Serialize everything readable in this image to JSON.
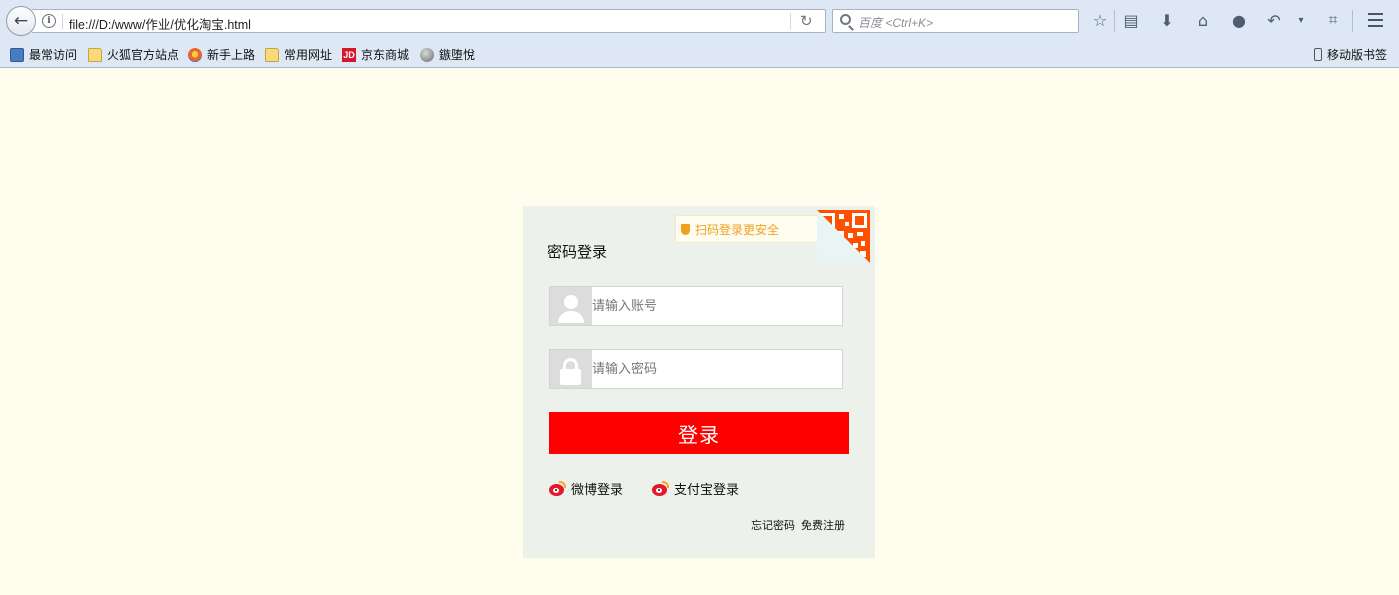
{
  "browser": {
    "url": "file:///D:/www/作业/优化淘宝.html",
    "search_placeholder": "百度 <Ctrl+K>",
    "bookmarks": [
      {
        "label": "最常访问",
        "icon": "most-visited-icon"
      },
      {
        "label": "火狐官方站点",
        "icon": "folder-icon"
      },
      {
        "label": "新手上路",
        "icon": "firefox-icon"
      },
      {
        "label": "常用网址",
        "icon": "folder-icon"
      },
      {
        "label": "京东商城",
        "icon": "jd-icon"
      },
      {
        "label": "鏃堕悅",
        "icon": "globe-icon"
      }
    ],
    "mobile_bookmarks": "移动版书签",
    "jd_icon_text": "JD",
    "info_icon_text": "i"
  },
  "login": {
    "qr_tip": "扫码登录更安全",
    "title": "密码登录",
    "account_placeholder": "请输入账号",
    "password_placeholder": "请输入密码",
    "submit_label": "登录",
    "weibo_label": "微博登录",
    "alipay_label": "支付宝登录",
    "forgot_label": "忘记密码",
    "register_label": "免费注册"
  },
  "colors": {
    "page_background": "#fffeee",
    "panel_background": "#edf1ec",
    "login_button": "#ff0000",
    "qr_tip_text": "#f0a120",
    "qr_code": "#ff5000"
  }
}
